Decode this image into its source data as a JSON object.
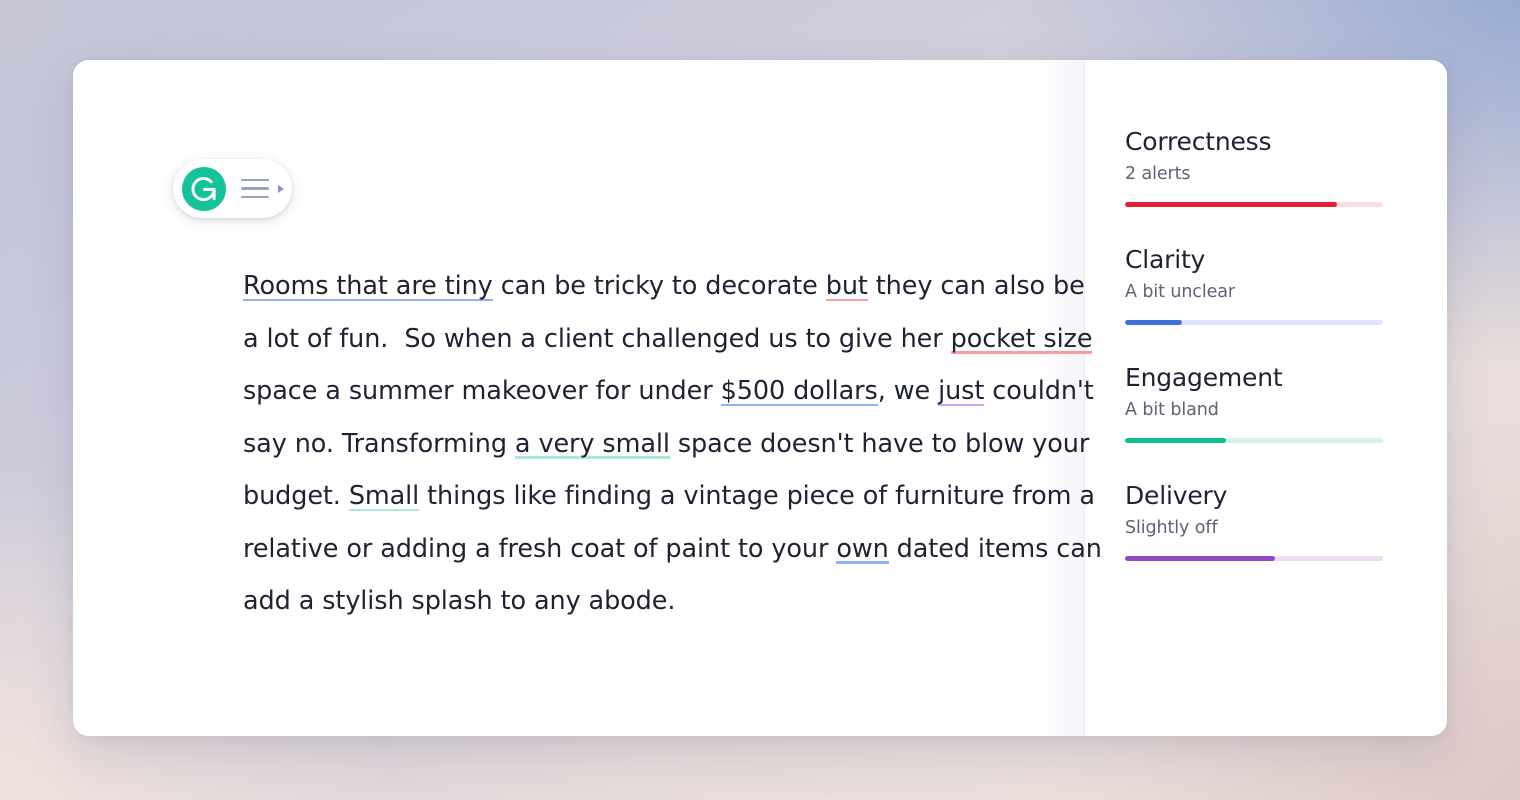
{
  "app": {
    "logo_icon": "grammarly-logo-icon",
    "menu_icon": "hamburger-menu-icon",
    "caret_icon": "caret-right-icon",
    "brand_color": "#15c39a"
  },
  "editor": {
    "paragraph_lines": [
      "Rooms that are tiny can be tricky to decorate but they can",
      "also be a lot of fun.  So when a client challenged us to give her",
      "pocket size space a summer makeover for under $500 dollars,",
      "we just couldn't say no. Transforming a very small space",
      "doesn't have to blow your budget. Small things like finding a",
      "vintage piece of furniture from a relative or adding a fresh",
      "coat of paint to your own dated items can add a stylish splash",
      "to any abode."
    ],
    "segments": [
      {
        "text": "Rooms that are tiny",
        "mark": "blue"
      },
      {
        "text": " can be tricky to decorate ",
        "mark": "none"
      },
      {
        "text": "but",
        "mark": "pink"
      },
      {
        "text": " they can also be a lot of fun.  So when a client challenged us to give her ",
        "mark": "none"
      },
      {
        "text": "pocket size",
        "mark": "pink"
      },
      {
        "text": " space a summer makeover for under ",
        "mark": "none"
      },
      {
        "text": "$500 dollars",
        "mark": "blue"
      },
      {
        "text": ", we ",
        "mark": "none"
      },
      {
        "text": "just",
        "mark": "purple"
      },
      {
        "text": " couldn't say no. Transforming ",
        "mark": "none"
      },
      {
        "text": "a very small",
        "mark": "green"
      },
      {
        "text": " space doesn't have to blow your budget. ",
        "mark": "none"
      },
      {
        "text": "Small",
        "mark": "green"
      },
      {
        "text": " things like finding a vintage piece of furniture from a relative or adding a fresh coat of paint to your ",
        "mark": "none"
      },
      {
        "text": "own",
        "mark": "blue"
      },
      {
        "text": " dated items can add a stylish splash to any abode.",
        "mark": "none"
      }
    ],
    "mark_colors": {
      "blue": "#8eb3f5",
      "pink": "#fd9aa8",
      "purple": "#d7a4f3",
      "green": "#a6ebd6"
    }
  },
  "sidebar": {
    "scores": [
      {
        "title": "Correctness",
        "status": "2 alerts",
        "percent": 82,
        "color": "#e61e32",
        "track_color": "#fbdde1"
      },
      {
        "title": "Clarity",
        "status": "A bit unclear",
        "percent": 22,
        "color": "#3d6fdb",
        "track_color": "#dbe6fa"
      },
      {
        "title": "Engagement",
        "status": "A bit bland",
        "percent": 39,
        "color": "#16bd8e",
        "track_color": "#d4f2e8"
      },
      {
        "title": "Delivery",
        "status": "Slightly off",
        "percent": 58,
        "color": "#9247c4",
        "track_color": "#ecdcf6"
      }
    ]
  }
}
